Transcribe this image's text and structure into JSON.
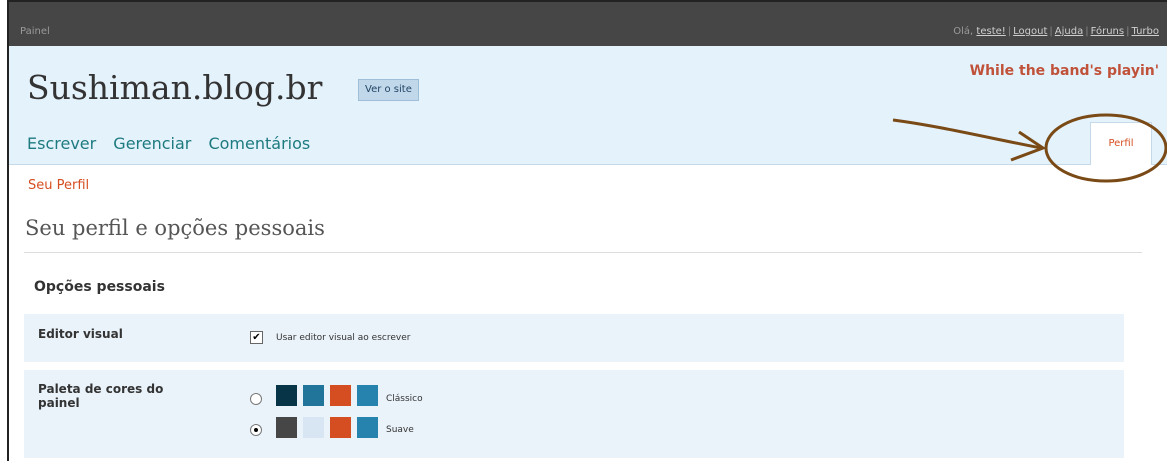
{
  "adminbar": {
    "brand": "Painel",
    "greeting": "Olá,",
    "username": "teste!",
    "links": [
      "Logout",
      "Ajuda",
      "Fóruns",
      "Turbo"
    ]
  },
  "header": {
    "site_title": "Sushiman.blog.br",
    "view_site_label": "Ver o site",
    "tagline": "While the band's playin'"
  },
  "nav": {
    "items": [
      "Escrever",
      "Gerenciar",
      "Comentários"
    ],
    "profile_tab": "Perfil"
  },
  "subnav": {
    "active": "Seu Perfil"
  },
  "page": {
    "heading": "Seu perfil e opções pessoais",
    "section_title": "Opções pessoais",
    "visual_editor": {
      "label": "Editor visual",
      "checkbox_label": "Usar editor visual ao escrever",
      "checked": true
    },
    "color_palette": {
      "label": "Paleta de cores do painel",
      "options": [
        {
          "name": "Clássico",
          "selected": false,
          "colors": [
            "#073447",
            "#21759b",
            "#d54e21",
            "#2683ae"
          ]
        },
        {
          "name": "Suave",
          "selected": true,
          "colors": [
            "#464646",
            "#d7e6f2",
            "#d54e21",
            "#2683ae"
          ]
        }
      ]
    }
  },
  "colors": {
    "topbar": "#464646",
    "header_bg": "#e4f2fc",
    "accent_orange": "#d54e21",
    "nav_teal": "#1d7a7f",
    "annotation_brown": "#7a4a16"
  }
}
